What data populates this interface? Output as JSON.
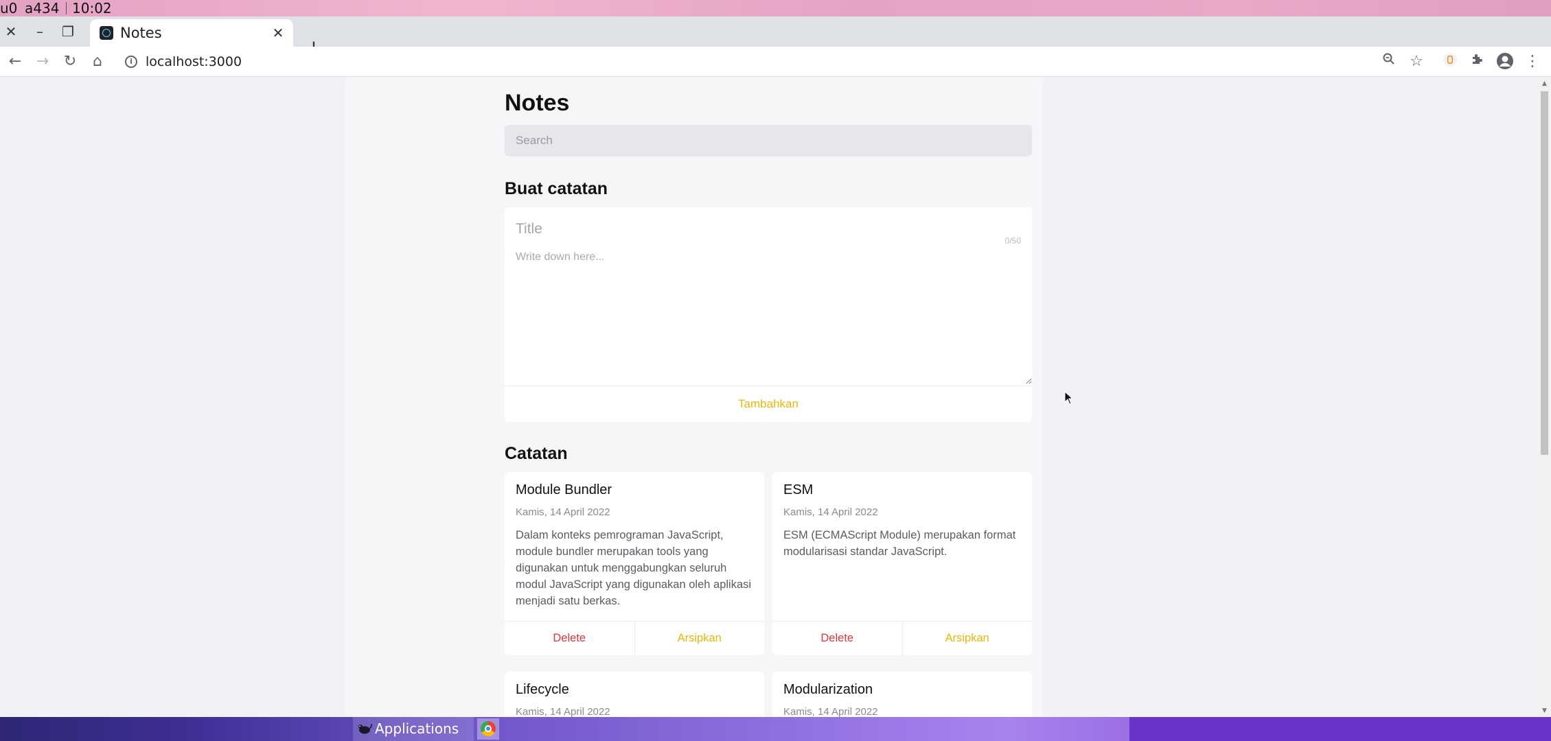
{
  "system_bar": {
    "workspace": "u0",
    "host": "a434",
    "time": "10:02"
  },
  "browser": {
    "tab": {
      "title": "Notes"
    },
    "address": "localhost:3000"
  },
  "page": {
    "heading": "Notes",
    "search_placeholder": "Search",
    "create_heading": "Buat catatan",
    "form": {
      "title_placeholder": "Title",
      "title_value": "",
      "counter": "0/50",
      "body_placeholder": "Write down here...",
      "body_value": "",
      "submit_label": "Tambahkan"
    },
    "notes_heading": "Catatan",
    "notes": [
      {
        "title": "Module Bundler",
        "date": "Kamis, 14 April 2022",
        "body": "Dalam konteks pemrograman JavaScript, module bundler merupakan tools yang digunakan untuk menggabungkan seluruh modul JavaScript yang digunakan oleh aplikasi menjadi satu berkas.",
        "delete_label": "Delete",
        "archive_label": "Arsipkan"
      },
      {
        "title": "ESM",
        "date": "Kamis, 14 April 2022",
        "body": "ESM (ECMAScript Module) merupakan format modularisasi standar JavaScript.",
        "delete_label": "Delete",
        "archive_label": "Arsipkan"
      },
      {
        "title": "Lifecycle",
        "date": "Kamis, 14 April 2022"
      },
      {
        "title": "Modularization",
        "date": "Kamis, 14 April 2022"
      }
    ]
  },
  "taskbar": {
    "applications_label": "Applications"
  },
  "colors": {
    "accent": "#e7b70b",
    "danger": "#d63a3a"
  }
}
